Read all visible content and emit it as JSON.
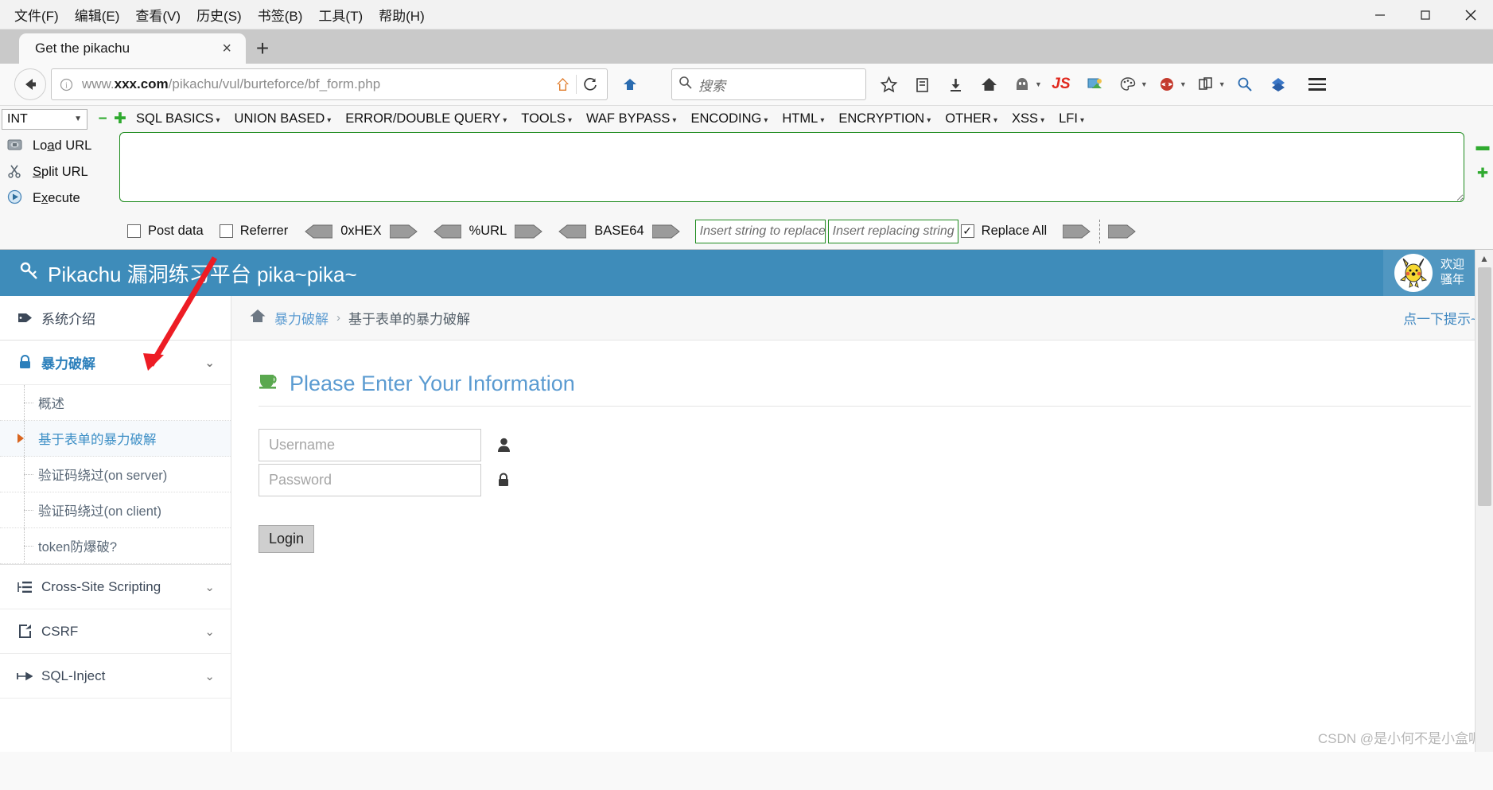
{
  "browser": {
    "menus": [
      "文件(F)",
      "编辑(E)",
      "查看(V)",
      "历史(S)",
      "书签(B)",
      "工具(T)",
      "帮助(H)"
    ],
    "window_controls": {
      "minimize": "minimize-icon",
      "maximize": "maximize-icon",
      "close": "close-icon"
    },
    "tab": {
      "title": "Get the pikachu",
      "close": "×",
      "new_tab": "+"
    },
    "url": {
      "prefix": "www.",
      "domain": "xxx.com",
      "path": "/pikachu/vul/burteforce/bf_form.php"
    },
    "search": {
      "placeholder": "搜索"
    },
    "toolbar_icons": [
      "star-icon",
      "library-icon",
      "download-icon",
      "home-icon",
      "account-icon",
      "js-icon",
      "screenshot-icon",
      "palette-icon",
      "shield-icon",
      "container-icon",
      "zoom-icon",
      "sync-icon",
      "menu-icon"
    ]
  },
  "hackbar": {
    "select_value": "INT",
    "minus": "−",
    "plus": "✚",
    "menus": [
      "SQL BASICS",
      "UNION BASED",
      "ERROR/DOUBLE QUERY",
      "TOOLS",
      "WAF BYPASS",
      "ENCODING",
      "HTML",
      "ENCRYPTION",
      "OTHER",
      "XSS",
      "LFI"
    ],
    "actions": [
      {
        "label_pre": "Lo",
        "label_u": "a",
        "label_post": "d URL",
        "icon": "load-url-icon"
      },
      {
        "label_pre": "",
        "label_u": "S",
        "label_post": "plit URL",
        "icon": "split-url-icon"
      },
      {
        "label_pre": "E",
        "label_u": "x",
        "label_post": "ecute",
        "icon": "execute-icon"
      }
    ],
    "textarea_value": "",
    "checkboxes": [
      {
        "label": "Post data",
        "checked": false
      },
      {
        "label": "Referrer",
        "checked": false
      }
    ],
    "encoders": [
      "0xHEX",
      "%URL",
      "BASE64"
    ],
    "replace": {
      "find_placeholder": "Insert string to replace",
      "replace_placeholder": "Insert replacing string",
      "replace_all_label": "Replace All",
      "replace_all_checked": true
    }
  },
  "pikachu": {
    "brand": "Pikachu 漏洞练习平台 pika~pika~",
    "brand_icon": "key-icon",
    "welcome_line1": "欢迎",
    "welcome_line2": "骚年",
    "avatar": "pikachu-avatar",
    "accent_color": "#3e8cba",
    "sidebar": [
      {
        "label": "系统介绍",
        "icon": "tag-icon",
        "type": "header",
        "expandable": false
      },
      {
        "label": "暴力破解",
        "icon": "lock-icon",
        "type": "group",
        "expandable": true,
        "active": true,
        "children": [
          {
            "label": "概述",
            "selected": false
          },
          {
            "label": "基于表单的暴力破解",
            "selected": true
          },
          {
            "label": "验证码绕过(on server)",
            "selected": false
          },
          {
            "label": "验证码绕过(on client)",
            "selected": false
          },
          {
            "label": "token防爆破?",
            "selected": false
          }
        ]
      },
      {
        "label": "Cross-Site Scripting",
        "icon": "xss-icon",
        "type": "group",
        "expandable": true
      },
      {
        "label": "CSRF",
        "icon": "csrf-icon",
        "type": "group",
        "expandable": true
      },
      {
        "label": "SQL-Inject",
        "icon": "sql-icon",
        "type": "group",
        "expandable": true
      }
    ],
    "breadcrumb": {
      "home_icon": "home-icon",
      "parent": "暴力破解",
      "separator": "›",
      "current": "基于表单的暴力破解",
      "hint_link": "点一下提示~"
    },
    "form": {
      "title": "Please Enter Your Information",
      "title_icon": "coffee-icon",
      "username_placeholder": "Username",
      "username_value": "",
      "username_icon": "user-icon",
      "password_placeholder": "Password",
      "password_value": "",
      "password_icon": "lock-icon",
      "submit_label": "Login"
    }
  },
  "watermark": "CSDN @是小何不是小盒呖"
}
